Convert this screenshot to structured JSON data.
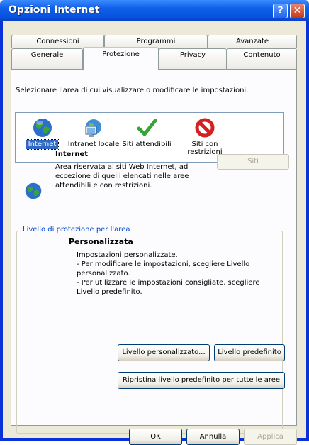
{
  "window": {
    "title": "Opzioni Internet",
    "help_glyph": "?",
    "close_glyph": "✕"
  },
  "tabs": {
    "row_back": [
      "Connessioni",
      "Programmi",
      "Avanzate"
    ],
    "row_front": [
      "Generale",
      "Protezione",
      "Privacy",
      "Contenuto"
    ],
    "selected": "Protezione"
  },
  "zones": {
    "prompt": "Selezionare l'area di cui visualizzare o modificare le impostazioni.",
    "items": [
      {
        "label": "Internet",
        "icon": "globe-icon",
        "selected": true
      },
      {
        "label": "Intranet locale",
        "icon": "intranet-icon",
        "selected": false
      },
      {
        "label": "Siti attendibili",
        "icon": "checkmark-icon",
        "selected": false
      },
      {
        "label_line1": "Siti con",
        "label_line2": "restrizioni",
        "icon": "restricted-icon",
        "selected": false
      }
    ]
  },
  "zone_detail": {
    "title": "Internet",
    "lines": [
      "Area riservata ai siti Web Internet, ad",
      "eccezione di quelli elencati nelle aree",
      "attendibili e con restrizioni."
    ],
    "sites_button": "Siti"
  },
  "security_level": {
    "group_label": "Livello di protezione per l'area",
    "level_title": "Personalizzata",
    "lines": [
      "Impostazioni personalizzate.",
      "- Per modificare le impostazioni, scegliere Livello",
      "personalizzato.",
      "- Per utilizzare le impostazioni consigliate, scegliere",
      "Livello predefinito."
    ],
    "custom_button": "Livello personalizzato...",
    "default_button": "Livello predefinito",
    "reset_button": "Ripristina livello predefinito per tutte le aree"
  },
  "footer": {
    "ok": "OK",
    "cancel": "Annulla",
    "apply": "Applica"
  },
  "colors": {
    "titlebar": "#0653e0",
    "dialog_bg": "#ece9d8",
    "panel_bg": "#fcfcfe",
    "selection": "#316ac5",
    "tab_highlight": "#ffc83c"
  }
}
